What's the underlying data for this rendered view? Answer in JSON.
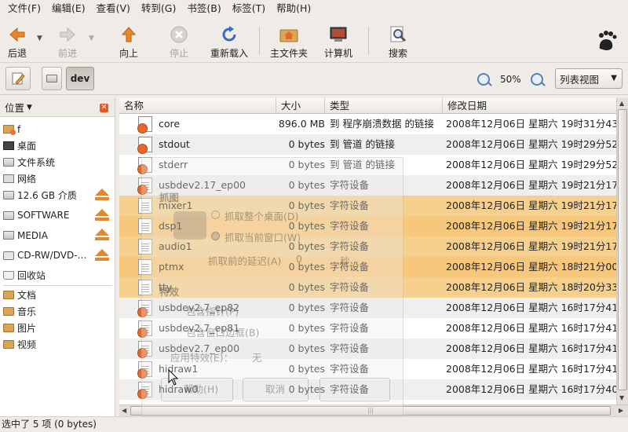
{
  "menubar": [
    "文件(F)",
    "编辑(E)",
    "查看(V)",
    "转到(G)",
    "书签(B)",
    "标签(T)",
    "帮助(H)"
  ],
  "toolbar": {
    "back": "后退",
    "forward": "前进",
    "up": "向上",
    "stop": "停止",
    "reload": "重新载入",
    "home": "主文件夹",
    "computer": "计算机",
    "search": "搜索"
  },
  "location": {
    "current": "dev",
    "zoom": "50%",
    "view_mode": "列表视图"
  },
  "sidebar": {
    "title": "位置",
    "items": [
      {
        "label": "f",
        "icon": "home-folder-icon"
      },
      {
        "label": "桌面",
        "icon": "desktop-icon"
      },
      {
        "label": "文件系统",
        "icon": "drive-icon"
      },
      {
        "label": "网络",
        "icon": "network-icon"
      },
      {
        "label": "12.6 GB 介质",
        "icon": "drive-icon",
        "eject": true
      },
      {
        "label": "SOFTWARE",
        "icon": "drive-icon",
        "eject": true
      },
      {
        "label": "MEDIA",
        "icon": "drive-icon",
        "eject": true
      },
      {
        "label": "CD-RW/DVD-…",
        "icon": "cdrom-icon",
        "eject": true
      },
      {
        "label": "回收站",
        "icon": "trash-icon"
      },
      {
        "label": "文档",
        "icon": "folder-icon"
      },
      {
        "label": "音乐",
        "icon": "folder-icon"
      },
      {
        "label": "图片",
        "icon": "folder-icon"
      },
      {
        "label": "视频",
        "icon": "folder-icon"
      }
    ]
  },
  "columns": {
    "name": "名称",
    "size": "大小",
    "type": "类型",
    "modified": "修改日期"
  },
  "files": [
    {
      "name": "core",
      "size": "896.0 MB",
      "type": "到 程序崩溃数据 的链接",
      "modified": "2008年12月06日 星期六 19时31分43",
      "kind": "link",
      "selected": false
    },
    {
      "name": "stdout",
      "size": "0 bytes",
      "type": "到 管道 的链接",
      "modified": "2008年12月06日 星期六 19时29分52",
      "kind": "link",
      "selected": false
    },
    {
      "name": "stderr",
      "size": "0 bytes",
      "type": "到 管道 的链接",
      "modified": "2008年12月06日 星期六 19时29分52",
      "kind": "link",
      "selected": false
    },
    {
      "name": "usbdev2.17_ep00",
      "size": "0 bytes",
      "type": "字符设备",
      "modified": "2008年12月06日 星期六 19时21分17",
      "kind": "devlink",
      "selected": false
    },
    {
      "name": "mixer1",
      "size": "0 bytes",
      "type": "字符设备",
      "modified": "2008年12月06日 星期六 19时21分17",
      "kind": "dev",
      "selected": true
    },
    {
      "name": "dsp1",
      "size": "0 bytes",
      "type": "字符设备",
      "modified": "2008年12月06日 星期六 19时21分17",
      "kind": "dev",
      "selected": true
    },
    {
      "name": "audio1",
      "size": "0 bytes",
      "type": "字符设备",
      "modified": "2008年12月06日 星期六 19时21分17",
      "kind": "dev",
      "selected": true
    },
    {
      "name": "ptmx",
      "size": "0 bytes",
      "type": "字符设备",
      "modified": "2008年12月06日 星期六 18时21分00",
      "kind": "dev",
      "selected": true
    },
    {
      "name": "tty",
      "size": "0 bytes",
      "type": "字符设备",
      "modified": "2008年12月06日 星期六 18时20分33",
      "kind": "dev",
      "selected": true
    },
    {
      "name": "usbdev2.7_ep82",
      "size": "0 bytes",
      "type": "字符设备",
      "modified": "2008年12月06日 星期六 16时17分41",
      "kind": "devlink",
      "selected": false
    },
    {
      "name": "usbdev2.7_ep81",
      "size": "0 bytes",
      "type": "字符设备",
      "modified": "2008年12月06日 星期六 16时17分41",
      "kind": "devlink",
      "selected": false
    },
    {
      "name": "usbdev2.7_ep00",
      "size": "0 bytes",
      "type": "字符设备",
      "modified": "2008年12月06日 星期六 16时17分41",
      "kind": "devlink",
      "selected": false
    },
    {
      "name": "hidraw1",
      "size": "0 bytes",
      "type": "字符设备",
      "modified": "2008年12月06日 星期六 16时17分41",
      "kind": "devlink",
      "selected": false
    },
    {
      "name": "hidraw0",
      "size": "0 bytes",
      "type": "字符设备",
      "modified": "2008年12月06日 星期六 16时17分40",
      "kind": "devlink",
      "selected": false
    }
  ],
  "status": "选中了 5 项 (0 bytes)",
  "ghost_dialog": {
    "section_grab": "抓图",
    "grab_desktop": "抓取整个桌面(D)",
    "grab_window": "抓取当前窗口(W)",
    "delay_label": "抓取前的延迟(A)",
    "delay_value": "0",
    "delay_unit": "秒",
    "section_effects": "特效",
    "include_pointer": "包含指针(P)",
    "include_border": "包含窗口边框(B)",
    "apply_effect": "应用特效(E)：",
    "effect_value": "无",
    "help": "帮助(H)",
    "cancel": "取消"
  },
  "colors": {
    "selection": "#f5d08e",
    "accent_orange": "#e8662a",
    "eject": "#e8862a"
  }
}
